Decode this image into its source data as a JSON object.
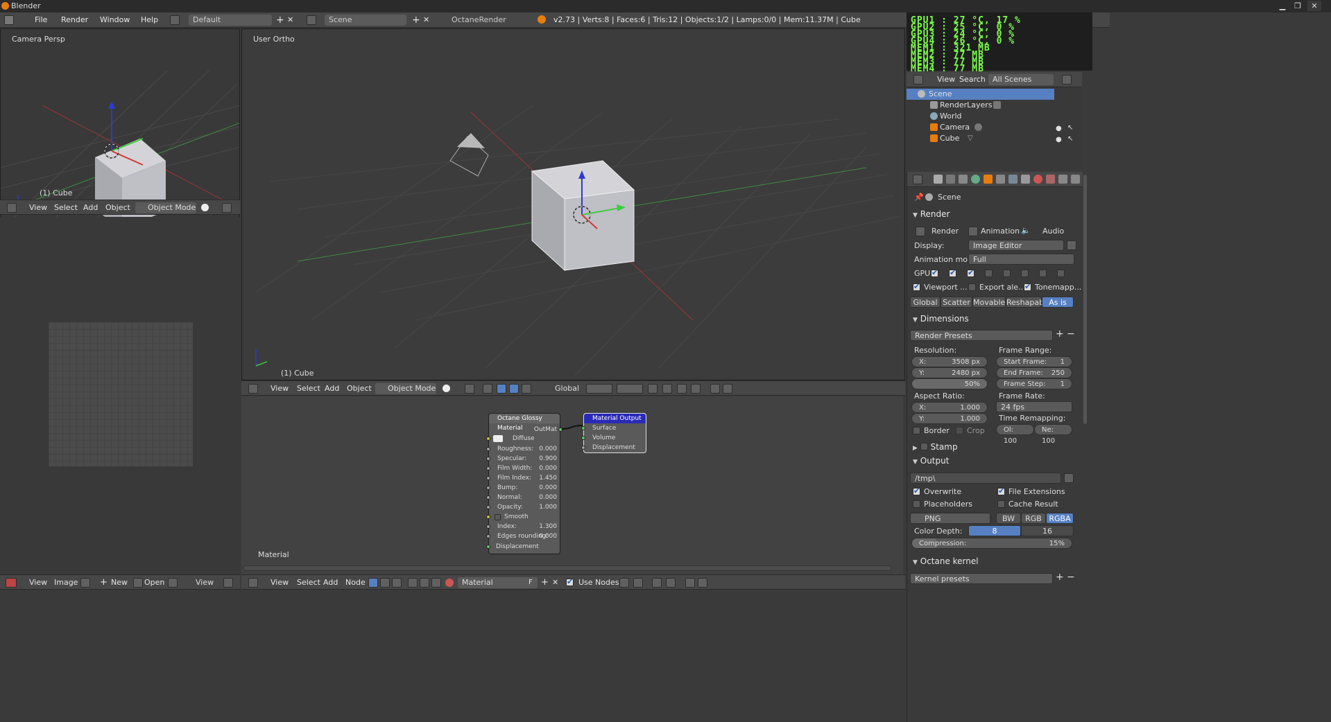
{
  "window": {
    "title": "Blender"
  },
  "topbar": {
    "menus": [
      "File",
      "Render",
      "Window",
      "Help"
    ],
    "layout": "Default",
    "scene": "Scene",
    "engine": "OctaneRender",
    "stats": "v2.73 | Verts:8 | Faces:6 | Tris:12 | Objects:1/2 | Lamps:0/0 | Mem:11.37M | Cube"
  },
  "gpu_monitor": {
    "lines": [
      "GPU1  : 27 °C, 17 %",
      "GPU2  : 25 °C, 0 %",
      "GPU3  : 24 °C, 0 %",
      "GPU4  : 26 °C, 0 %",
      "MEM1  : 321 MB",
      "MEM2  : 77 MB",
      "MEM3  : 77 MB",
      "MEM4  : 77 MB"
    ]
  },
  "camera_view": {
    "label": "Camera Persp",
    "object": "(1) Cube"
  },
  "camera_header": {
    "items": [
      "View",
      "Select",
      "Add",
      "Object"
    ],
    "mode": "Object Mode"
  },
  "main_view": {
    "label": "User Ortho",
    "object": "(1) Cube"
  },
  "main_header": {
    "items": [
      "View",
      "Select",
      "Add",
      "Object"
    ],
    "mode": "Object Mode",
    "orientation": "Global"
  },
  "outliner": {
    "header": {
      "view": "View",
      "search": "Search",
      "filter": "All Scenes"
    },
    "items": [
      {
        "label": "Scene"
      },
      {
        "label": "RenderLayers"
      },
      {
        "label": "World"
      },
      {
        "label": "Camera"
      },
      {
        "label": "Cube"
      }
    ]
  },
  "props": {
    "context": "Scene",
    "render": {
      "title": "Render",
      "buttons": [
        "Render",
        "Animation",
        "Audio"
      ],
      "display_label": "Display:",
      "display_value": "Image Editor",
      "anim_label": "Animation mo...",
      "anim_value": "Full",
      "gpu_label": "GPU:",
      "viewport": "Viewport ...",
      "export": "Export ale...",
      "tonemap": "Tonemapp...",
      "modes": [
        "Global",
        "Scatter",
        "Movable",
        "Reshapabl",
        "As is"
      ]
    },
    "dimensions": {
      "title": "Dimensions",
      "presets": "Render Presets",
      "resolution": "Resolution:",
      "res_x": "X:",
      "res_x_val": "3508 px",
      "res_y": "Y:",
      "res_y_val": "2480 px",
      "res_pct": "50%",
      "frame_range": "Frame Range:",
      "start": "Start Frame:",
      "start_val": "1",
      "end": "End Frame:",
      "end_val": "250",
      "step": "Frame Step:",
      "step_val": "1",
      "aspect": "Aspect Ratio:",
      "asp_x": "X:",
      "asp_x_val": "1.000",
      "asp_y": "Y:",
      "asp_y_val": "1.000",
      "frame_rate": "Frame Rate:",
      "fps": "24 fps",
      "time_remap": "Time Remapping:",
      "old": "Ol: 100",
      "new": "Ne: 100",
      "border": "Border",
      "crop": "Crop"
    },
    "stamp": {
      "title": "Stamp"
    },
    "output": {
      "title": "Output",
      "path": "/tmp\\",
      "overwrite": "Overwrite",
      "file_ext": "File Extensions",
      "placeholders": "Placeholders",
      "cache": "Cache Result",
      "format": "PNG",
      "bw": "BW",
      "rgb": "RGB",
      "rgba": "RGBA",
      "color_depth": "Color Depth:",
      "depth8": "8",
      "depth16": "16",
      "compression": "Compression:",
      "compression_val": "15%"
    },
    "octane_kernel": {
      "title": "Octane kernel",
      "presets": "Kernel presets"
    }
  },
  "node_editor": {
    "label": "Material",
    "glossy": {
      "title": "Octane Glossy Material",
      "out": "OutMat",
      "diffuse": "Diffuse",
      "params": [
        {
          "name": "Roughness:",
          "value": "0.000"
        },
        {
          "name": "Specular:",
          "value": "0.900"
        },
        {
          "name": "Film Width:",
          "value": "0.000"
        },
        {
          "name": "Film Index:",
          "value": "1.450"
        },
        {
          "name": "Bump:",
          "value": "0.000"
        },
        {
          "name": "Normal:",
          "value": "0.000"
        },
        {
          "name": "Opacity:",
          "value": "1.000"
        }
      ],
      "smooth": "Smooth",
      "index": "Index:",
      "index_val": "1.300",
      "edges": "Edges rounding:",
      "edges_val": "0.000",
      "displacement": "Displacement"
    },
    "output": {
      "title": "Material Output",
      "inputs": [
        "Surface",
        "Volume",
        "Displacement"
      ]
    }
  },
  "bottom_left_header": {
    "items": [
      "View",
      "Image"
    ],
    "new": "New",
    "open": "Open",
    "view2": "View"
  },
  "node_header": {
    "items": [
      "View",
      "Select",
      "Add",
      "Node"
    ],
    "material": "Material",
    "use_nodes": "Use Nodes",
    "f": "F"
  }
}
